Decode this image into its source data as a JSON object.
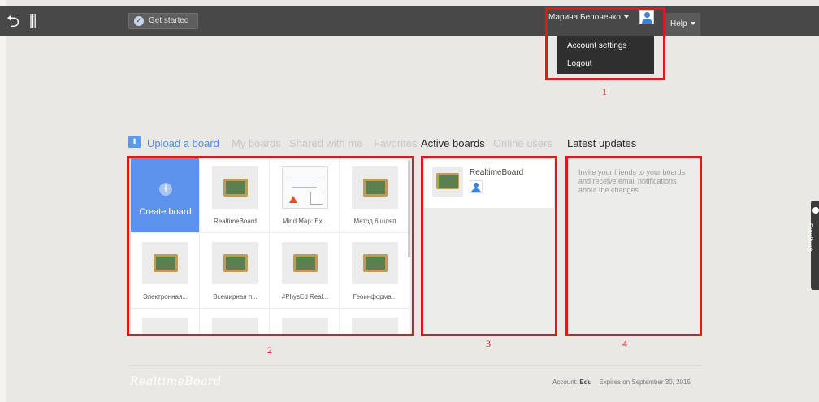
{
  "topbar": {
    "back_icon": "undo-arrow-icon",
    "panel_icon": "sidebar-toggle-icon",
    "get_started_label": "Get started",
    "user_name": "Марина Белоненко",
    "help_label": "Help"
  },
  "user_dropdown": {
    "items": [
      "Account settings",
      "Logout"
    ]
  },
  "markers": [
    "1",
    "2",
    "3",
    "4"
  ],
  "tabs": {
    "upload": "Upload a board",
    "my_boards": "My boards",
    "shared": "Shared with me",
    "favorites": "Favorites"
  },
  "sections": {
    "active_boards": "Active boards",
    "online_users": "Online users",
    "latest_updates": "Latest updates"
  },
  "boards": {
    "create_label": "Create board",
    "items": [
      "RealtimeBoard",
      "Mind Map: Ex...",
      "Метод 6 шляп",
      "Электронная...",
      "Всемирная п...",
      "#PhysEd Real...",
      "Геоинформа..."
    ]
  },
  "active_boards": {
    "items": [
      {
        "name": "RealtimeBoard"
      }
    ]
  },
  "latest_updates": {
    "message": "Invite your friends to your boards and receive email notifications about the changes"
  },
  "feedback_tab": {
    "label": "Feedback"
  },
  "footer": {
    "logo": "RealtimeBoard",
    "account_label": "Account:",
    "account_plan": "Edu",
    "expires": "Expires on September 30, 2015"
  },
  "colors": {
    "topbar": "#484848",
    "accent": "#5d92ec",
    "highlight": "#e01818"
  }
}
